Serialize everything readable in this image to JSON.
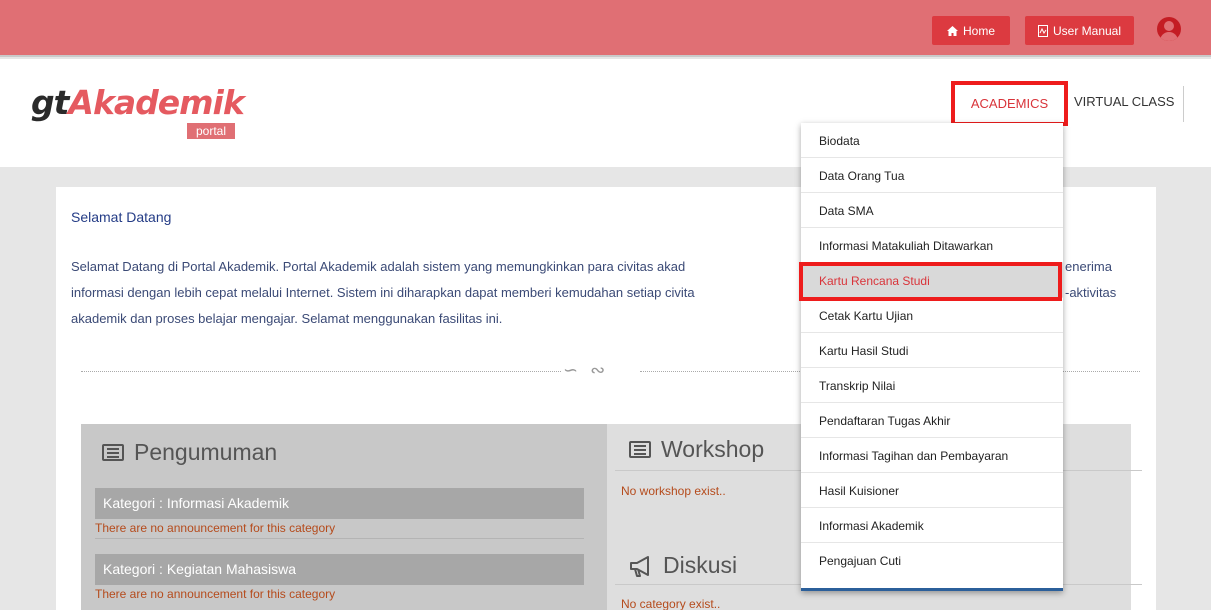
{
  "topbar": {
    "home_label": "Home",
    "manual_label": "User Manual",
    "colors": {
      "bar": "#e06f74",
      "button": "#dc3a40"
    }
  },
  "logo": {
    "gt": "gt",
    "akademik": "Akademik",
    "portal": "portal"
  },
  "nav": {
    "academics": "ACADEMICS",
    "virtual_class": "VIRTUAL CLASS"
  },
  "dropdown": {
    "items": [
      "Biodata",
      "Data Orang Tua",
      "Data SMA",
      "Informasi Matakuliah Ditawarkan",
      "Kartu Rencana Studi",
      "Cetak Kartu Ujian",
      "Kartu Hasil Studi",
      "Transkrip Nilai",
      "Pendaftaran Tugas Akhir",
      "Informasi Tagihan dan Pembayaran",
      "Hasil Kuisioner",
      "Informasi Akademik",
      "Pengajuan Cuti"
    ],
    "active_item": "Kartu Rencana Studi"
  },
  "welcome": {
    "title": "Selamat Datang",
    "line1": "Selamat Datang di Portal Akademik. Portal Akademik adalah sistem yang memungkinkan para civitas akad",
    "line1_end": "enerima",
    "line2": "informasi dengan lebih cepat melalui Internet. Sistem ini diharapkan dapat memberi kemudahan setiap civita",
    "line2_end": "-aktivitas",
    "line3": "akademik dan proses belajar mengajar. Selamat menggunakan fasilitas ini."
  },
  "pengumuman": {
    "title": "Pengumuman",
    "categories": [
      {
        "label": "Kategori : Informasi Akademik",
        "empty": "There are no announcement for this category"
      },
      {
        "label": "Kategori : Kegiatan Mahasiswa",
        "empty": "There are no announcement for this category"
      }
    ]
  },
  "workshop": {
    "title": "Workshop",
    "empty": "No workshop exist.."
  },
  "diskusi": {
    "title": "Diskusi",
    "empty": "No category exist.."
  }
}
